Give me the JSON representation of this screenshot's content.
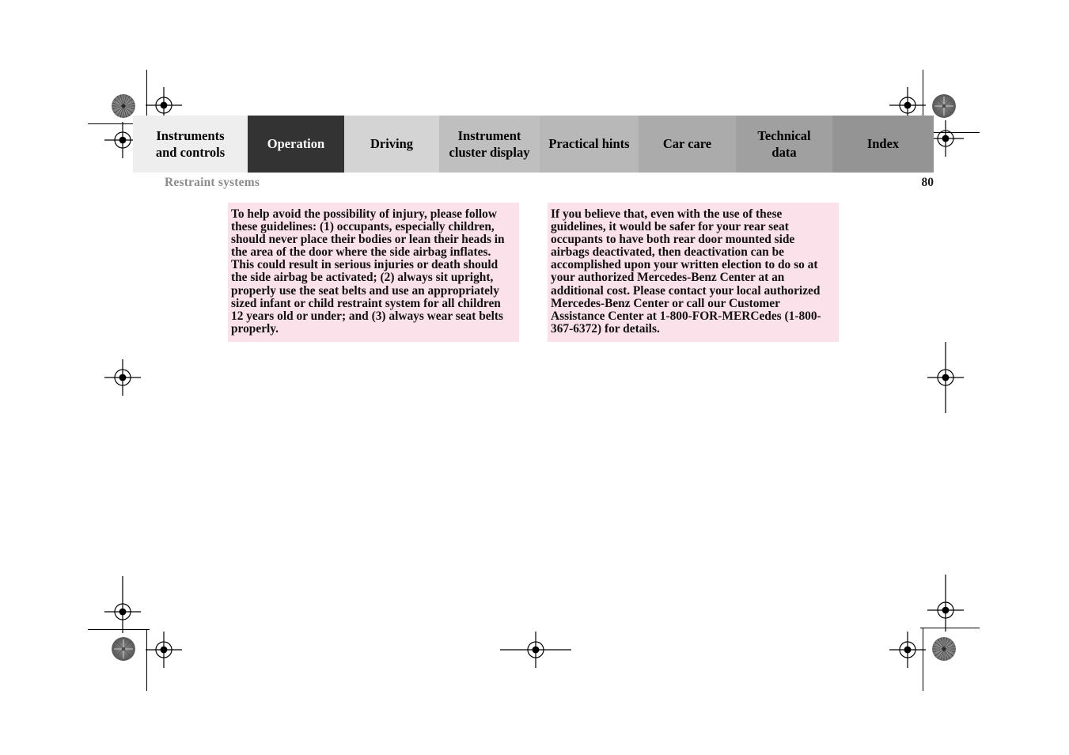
{
  "page": {
    "background_color": "#ffffff",
    "sheet_type": "printed-manual-page-with-registration-marks"
  },
  "tabbar": {
    "tabs": [
      {
        "label": "Instruments\nand controls",
        "label_line1": "Instruments",
        "label_line2": "and controls",
        "color": "#eeeeee",
        "text_color": "#000000",
        "active": false
      },
      {
        "label": "Operation",
        "label_line1": "Operation",
        "label_line2": "",
        "color": "#333333",
        "text_color": "#ffffff",
        "active": true
      },
      {
        "label": "Driving",
        "label_line1": "Driving",
        "label_line2": "",
        "color": "#d4d4d4",
        "text_color": "#000000",
        "active": false
      },
      {
        "label": "Instrument\ncluster display",
        "label_line1": "Instrument",
        "label_line2": "cluster display",
        "color": "#bfbfbf",
        "text_color": "#000000",
        "active": false
      },
      {
        "label": "Practical hints",
        "label_line1": "Practical hints",
        "label_line2": "",
        "color": "#b8b8b8",
        "text_color": "#000000",
        "active": false
      },
      {
        "label": "Car care",
        "label_line1": "Car care",
        "label_line2": "",
        "color": "#ababab",
        "text_color": "#000000",
        "active": false
      },
      {
        "label": "Technical\ndata",
        "label_line1": "Technical",
        "label_line2": "data",
        "color": "#a0a0a0",
        "text_color": "#000000",
        "active": false
      },
      {
        "label": "Index",
        "label_line1": "Index",
        "label_line2": "",
        "color": "#949494",
        "text_color": "#000000",
        "active": false
      }
    ]
  },
  "running_head": {
    "section_title": "Restraint systems",
    "page_number": "80",
    "title_color": "#8c8c8c",
    "page_number_color": "#1a1a1a"
  },
  "content": {
    "warning_background_color": "#fbe1ea",
    "blocks": [
      {
        "id": "side-airbag-guidelines",
        "text": "To help avoid the possibility of injury, please follow these guidelines: (1) occupants, especially children, should never place their bodies or lean their heads in the area of the door where the side airbag inflates. This could result in serious injuries or death should the side airbag be activated; (2) always sit upright, properly use the seat belts and use an appropriately sized infant or child restraint system for all children 12 years old or under; and (3) always wear seat belts properly."
      },
      {
        "id": "deactivation-request",
        "text": "If you believe that, even with the use of these guidelines, it would be safer for your rear seat occupants to have both rear door mounted side airbags deactivated, then deactivation can be accomplished upon your written election to do so at your authorized Mercedes-Benz Center at an additional cost. Please contact your local authorized Mercedes-Benz Center or call our Customer Assistance Center at 1-800-FOR-MERCedes (1-800-367-6372) for details."
      }
    ]
  },
  "print_marks": {
    "registration_target_count": 10,
    "starburst_disc_count": 4,
    "mark_color": "#000000"
  }
}
